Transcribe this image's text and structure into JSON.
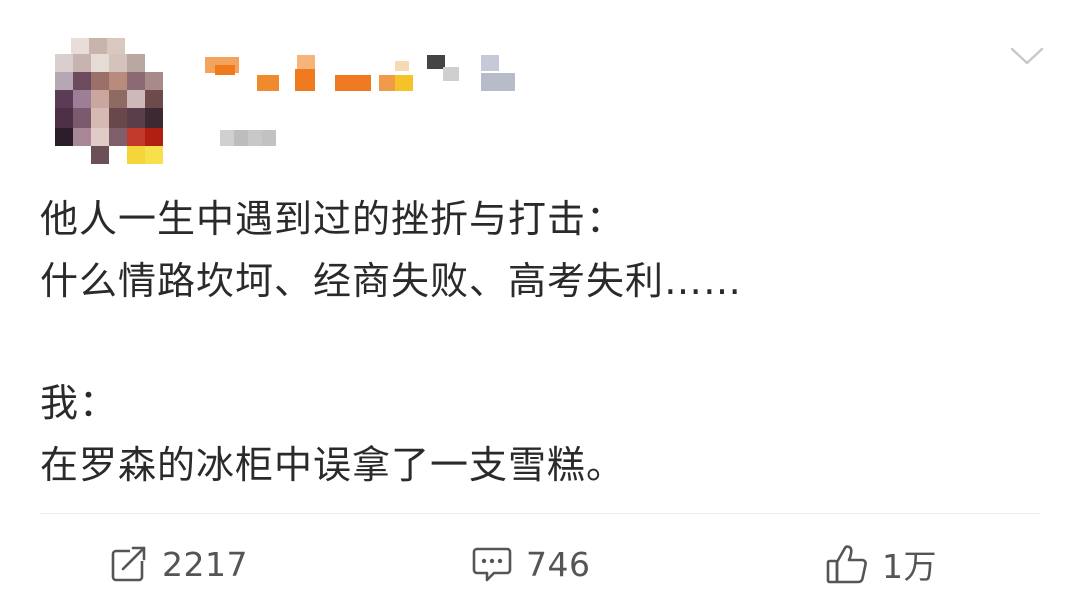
{
  "post": {
    "content_lines": [
      "他人一生中遇到过的挫折与打击：",
      "什么情路坎坷、经商失败、高考失利……",
      "",
      "我：",
      "在罗森的冰柜中误拿了一支雪糕。"
    ]
  },
  "actions": {
    "repost_count": "2217",
    "comment_count": "746",
    "like_count": "1万"
  },
  "icons": {
    "more": "chevron-down-icon",
    "repost": "repost-icon",
    "comment": "comment-icon",
    "like": "thumbs-up-icon"
  },
  "colors": {
    "text": "#2a2a2a",
    "count": "#555555",
    "icon": "#555555",
    "chevron": "#c8c8c8"
  }
}
